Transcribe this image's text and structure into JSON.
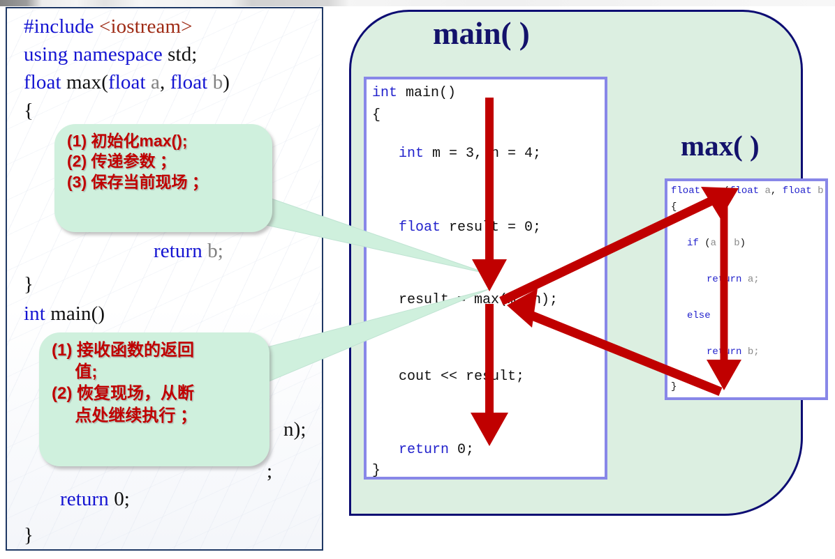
{
  "slide": {
    "title_main": "main( )",
    "title_max": "max( )",
    "accent_red": "#c00000",
    "bubble_green": "#cff0dd",
    "panel_green": "#dcefe1",
    "navy_border": "#0d0d73",
    "code_border": "#8887e8"
  },
  "left_listing": {
    "lines": [
      {
        "id": "l1",
        "parts": [
          {
            "t": "#include ",
            "c": "kw"
          },
          {
            "t": "<iostream>",
            "c": "hdr"
          }
        ]
      },
      {
        "id": "l2",
        "parts": [
          {
            "t": "using namespace ",
            "c": "kw"
          },
          {
            "t": "std;",
            "c": "blk"
          }
        ]
      },
      {
        "id": "l3",
        "parts": [
          {
            "t": "float ",
            "c": "kw"
          },
          {
            "t": "max(",
            "c": "blk"
          },
          {
            "t": "float ",
            "c": "kw"
          },
          {
            "t": "a",
            "c": "gry"
          },
          {
            "t": ", ",
            "c": "blk"
          },
          {
            "t": "float ",
            "c": "kw"
          },
          {
            "t": "b",
            "c": "gry"
          },
          {
            "t": ")",
            "c": "blk"
          }
        ]
      },
      {
        "id": "l4",
        "parts": [
          {
            "t": "{",
            "c": "blk"
          }
        ]
      },
      {
        "id": "l5",
        "parts": [
          {
            "t": "        return ",
            "c": "kw"
          },
          {
            "t": "b;",
            "c": "gry"
          }
        ]
      },
      {
        "id": "l6",
        "parts": [
          {
            "t": "}",
            "c": "blk"
          }
        ]
      },
      {
        "id": "l7",
        "parts": [
          {
            "t": "int ",
            "c": "kw"
          },
          {
            "t": "main()",
            "c": "blk"
          }
        ]
      },
      {
        "id": "l8",
        "parts": [
          {
            "t": "n);",
            "c": "blk"
          }
        ]
      },
      {
        "id": "l9",
        "parts": [
          {
            "t": ";",
            "c": "blk"
          }
        ]
      },
      {
        "id": "l10",
        "parts": [
          {
            "t": "    return ",
            "c": "kw"
          },
          {
            "t": "0;",
            "c": "blk"
          }
        ]
      },
      {
        "id": "l11",
        "parts": [
          {
            "t": "}",
            "c": "blk"
          }
        ]
      }
    ]
  },
  "main_code": {
    "lines": [
      "int main()",
      "{",
      "    int m = 3, n = 4;",
      "    float result = 0;",
      "    result = max(m, n);",
      "    cout << result;",
      "    return 0;",
      "}"
    ]
  },
  "max_code": {
    "lines": [
      "float max(float a, float b)",
      "{",
      "    if (a > b)",
      "        return a;",
      "    else",
      "        return b;",
      "}"
    ]
  },
  "callout_1": {
    "lines": [
      "(1) 初始化max();",
      "(2) 传递参数 ；",
      "(3) 保存当前现场 ；"
    ]
  },
  "callout_2": {
    "lines": [
      "(1) 接收函数的返回",
      "     值;",
      "(2) 恢复现场，从断",
      "     点处继续执行 ；"
    ]
  }
}
